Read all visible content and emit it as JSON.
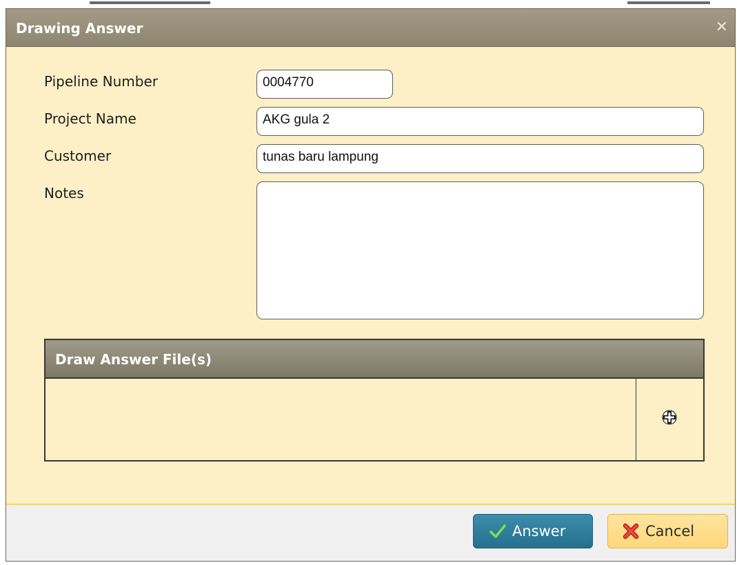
{
  "dialog": {
    "title": "Drawing Answer",
    "close_icon": "close-icon"
  },
  "form": {
    "pipeline_number": {
      "label": "Pipeline Number",
      "value": "0004770"
    },
    "project_name": {
      "label": "Project Name",
      "value": "AKG gula 2"
    },
    "customer": {
      "label": "Customer",
      "value": "tunas baru lampung"
    },
    "notes": {
      "label": "Notes",
      "value": ""
    }
  },
  "files": {
    "header": "Draw Answer File(s)",
    "add_icon": "plus-icon"
  },
  "buttons": {
    "answer": {
      "label": "Answer",
      "icon": "check-icon"
    },
    "cancel": {
      "label": "Cancel",
      "icon": "x-icon"
    }
  },
  "colors": {
    "title_bar": "#968e79",
    "body_bg": "#fdefc6",
    "answer_bg": "#2e7fa0",
    "cancel_bg": "#fedc86"
  }
}
